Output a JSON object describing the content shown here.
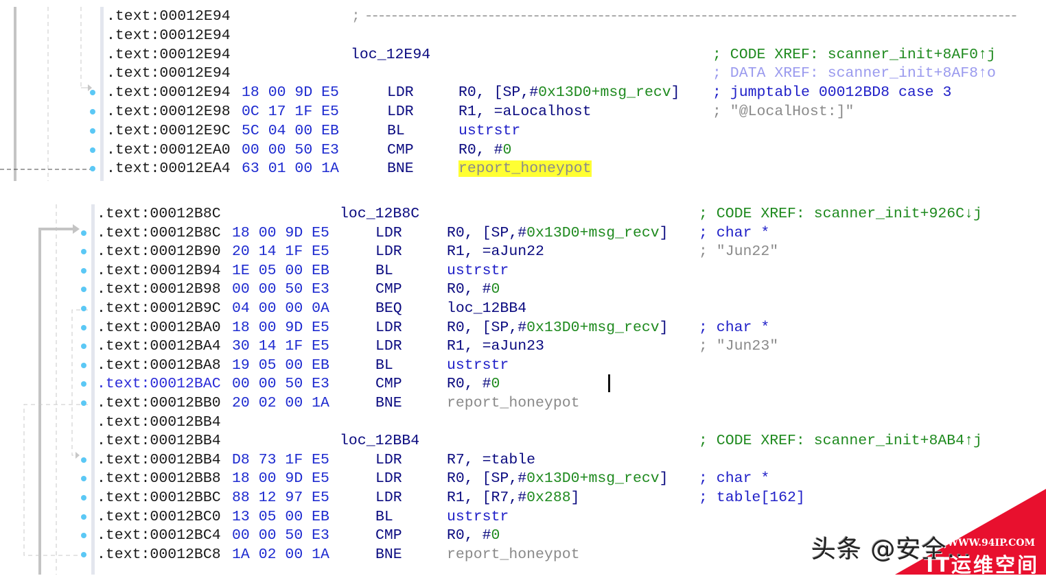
{
  "colors": {
    "bytes": "#1e2bd0",
    "code_xref": "#1f8a1f",
    "data_xref": "#9a9aee",
    "highlight": "#ffff33",
    "breakpoint_dot": "#5bc8f5"
  },
  "top_panel": {
    "rows": [
      {
        "addr": ".text:00012E94",
        "comment": [
          [
            "; -----------------------------------------------------------------------------------------------------",
            "cm-sep"
          ]
        ],
        "comment_at": "sep"
      },
      {
        "addr": ".text:00012E94"
      },
      {
        "addr": ".text:00012E94",
        "label": "loc_12E94",
        "comment": [
          [
            "; CODE XREF: scanner_init+8AF0↑j",
            "cm-code"
          ]
        ]
      },
      {
        "addr": ".text:00012E94",
        "comment": [
          [
            "; DATA XREF: scanner_init+8AF8↑o",
            "cm-data"
          ]
        ]
      },
      {
        "addr": ".text:00012E94",
        "bytes": "18 00 9D E5",
        "mn": "LDR",
        "ops": [
          [
            "R0, [SP,#",
            "c-reg"
          ],
          [
            "0x13D0+msg_recv",
            "c-imm"
          ],
          [
            "]",
            "c-reg"
          ]
        ],
        "comment": [
          [
            "; jumptable 00012BD8 case 3",
            "cm-jt"
          ]
        ],
        "dot": true,
        "arrow": true
      },
      {
        "addr": ".text:00012E98",
        "bytes": "0C 17 1F E5",
        "mn": "LDR",
        "ops": [
          [
            "R1, =aLocalhost",
            "c-reg"
          ]
        ],
        "comment": [
          [
            "; \"@LocalHost:]\"",
            "cm-str"
          ]
        ],
        "dot": true
      },
      {
        "addr": ".text:00012E9C",
        "bytes": "5C 04 00 EB",
        "mn": "BL",
        "ops": [
          [
            "ustrstr",
            "c-fn"
          ]
        ],
        "dot": true
      },
      {
        "addr": ".text:00012EA0",
        "bytes": "00 00 50 E3",
        "mn": "CMP",
        "ops": [
          [
            "R0, #",
            "c-reg"
          ],
          [
            "0",
            "c-imm"
          ]
        ],
        "dot": true
      },
      {
        "addr": ".text:00012EA4",
        "bytes": "63 01 00 1A",
        "mn": "BNE",
        "ops": [
          [
            "report_honeypot",
            "c-hl"
          ]
        ],
        "dot": true
      }
    ]
  },
  "bottom_panel": {
    "rows": [
      {
        "addr": ".text:00012B8C",
        "label": "loc_12B8C",
        "comment": [
          [
            "; CODE XREF: scanner_init+926C↓j",
            "cm-code"
          ]
        ]
      },
      {
        "addr": ".text:00012B8C",
        "bytes": "18 00 9D E5",
        "mn": "LDR",
        "ops": [
          [
            "R0, [SP,#",
            "c-reg"
          ],
          [
            "0x13D0+msg_recv",
            "c-imm"
          ],
          [
            "]",
            "c-reg"
          ]
        ],
        "comment": [
          [
            "; char *",
            "cm-type"
          ]
        ],
        "dot": true
      },
      {
        "addr": ".text:00012B90",
        "bytes": "20 14 1F E5",
        "mn": "LDR",
        "ops": [
          [
            "R1, =aJun22",
            "c-reg"
          ]
        ],
        "comment": [
          [
            "; \"Jun22\"",
            "cm-str"
          ]
        ],
        "dot": true
      },
      {
        "addr": ".text:00012B94",
        "bytes": "1E 05 00 EB",
        "mn": "BL",
        "ops": [
          [
            "ustrstr",
            "c-fn"
          ]
        ],
        "dot": true
      },
      {
        "addr": ".text:00012B98",
        "bytes": "00 00 50 E3",
        "mn": "CMP",
        "ops": [
          [
            "R0, #",
            "c-reg"
          ],
          [
            "0",
            "c-imm"
          ]
        ],
        "dot": true
      },
      {
        "addr": ".text:00012B9C",
        "bytes": "04 00 00 0A",
        "mn": "BEQ",
        "ops": [
          [
            "loc_12BB4",
            "c-reg"
          ]
        ],
        "dot": true
      },
      {
        "addr": ".text:00012BA0",
        "bytes": "18 00 9D E5",
        "mn": "LDR",
        "ops": [
          [
            "R0, [SP,#",
            "c-reg"
          ],
          [
            "0x13D0+msg_recv",
            "c-imm"
          ],
          [
            "]",
            "c-reg"
          ]
        ],
        "comment": [
          [
            "; char *",
            "cm-type"
          ]
        ],
        "dot": true
      },
      {
        "addr": ".text:00012BA4",
        "bytes": "30 14 1F E5",
        "mn": "LDR",
        "ops": [
          [
            "R1, =aJun23",
            "c-reg"
          ]
        ],
        "comment": [
          [
            "; \"Jun23\"",
            "cm-str"
          ]
        ],
        "dot": true
      },
      {
        "addr": ".text:00012BA8",
        "bytes": "19 05 00 EB",
        "mn": "BL",
        "ops": [
          [
            "ustrstr",
            "c-fn"
          ]
        ],
        "dot": true
      },
      {
        "addr": ".text:00012BAC",
        "bytes": "00 00 50 E3",
        "mn": "CMP",
        "ops": [
          [
            "R0, #",
            "c-reg"
          ],
          [
            "0",
            "c-imm"
          ]
        ],
        "dot": true,
        "selected": true
      },
      {
        "addr": ".text:00012BB0",
        "bytes": "20 02 00 1A",
        "mn": "BNE",
        "ops": [
          [
            "report_honeypot",
            "c-gray"
          ]
        ],
        "dot": true
      },
      {
        "addr": ".text:00012BB4"
      },
      {
        "addr": ".text:00012BB4",
        "label": "loc_12BB4",
        "comment": [
          [
            "; CODE XREF: scanner_init+8AB4↑j",
            "cm-code"
          ]
        ]
      },
      {
        "addr": ".text:00012BB4",
        "bytes": "D8 73 1F E5",
        "mn": "LDR",
        "ops": [
          [
            "R7, =table",
            "c-reg"
          ]
        ],
        "dot": true,
        "arrow": true
      },
      {
        "addr": ".text:00012BB8",
        "bytes": "18 00 9D E5",
        "mn": "LDR",
        "ops": [
          [
            "R0, [SP,#",
            "c-reg"
          ],
          [
            "0x13D0+msg_recv",
            "c-imm"
          ],
          [
            "]",
            "c-reg"
          ]
        ],
        "comment": [
          [
            "; char *",
            "cm-type"
          ]
        ],
        "dot": true
      },
      {
        "addr": ".text:00012BBC",
        "bytes": "88 12 97 E5",
        "mn": "LDR",
        "ops": [
          [
            "R1, [R7,#",
            "c-reg"
          ],
          [
            "0x288",
            "c-imm"
          ],
          [
            "]",
            "c-reg"
          ]
        ],
        "comment": [
          [
            "; table[162]",
            "cm-type"
          ]
        ],
        "dot": true
      },
      {
        "addr": ".text:00012BC0",
        "bytes": "13 05 00 EB",
        "mn": "BL",
        "ops": [
          [
            "ustrstr",
            "c-fn"
          ]
        ],
        "dot": true
      },
      {
        "addr": ".text:00012BC4",
        "bytes": "00 00 50 E3",
        "mn": "CMP",
        "ops": [
          [
            "R0, #",
            "c-reg"
          ],
          [
            "0",
            "c-imm"
          ]
        ],
        "dot": true
      },
      {
        "addr": ".text:00012BC8",
        "bytes": "1A 02 00 1A",
        "mn": "BNE",
        "ops": [
          [
            "report_honeypot",
            "c-gray"
          ]
        ],
        "dot": true
      }
    ]
  },
  "watermark": {
    "author": "头条 @安全…",
    "site_url": "WWW.94IP.COM",
    "site_name": "IT运维空间"
  }
}
